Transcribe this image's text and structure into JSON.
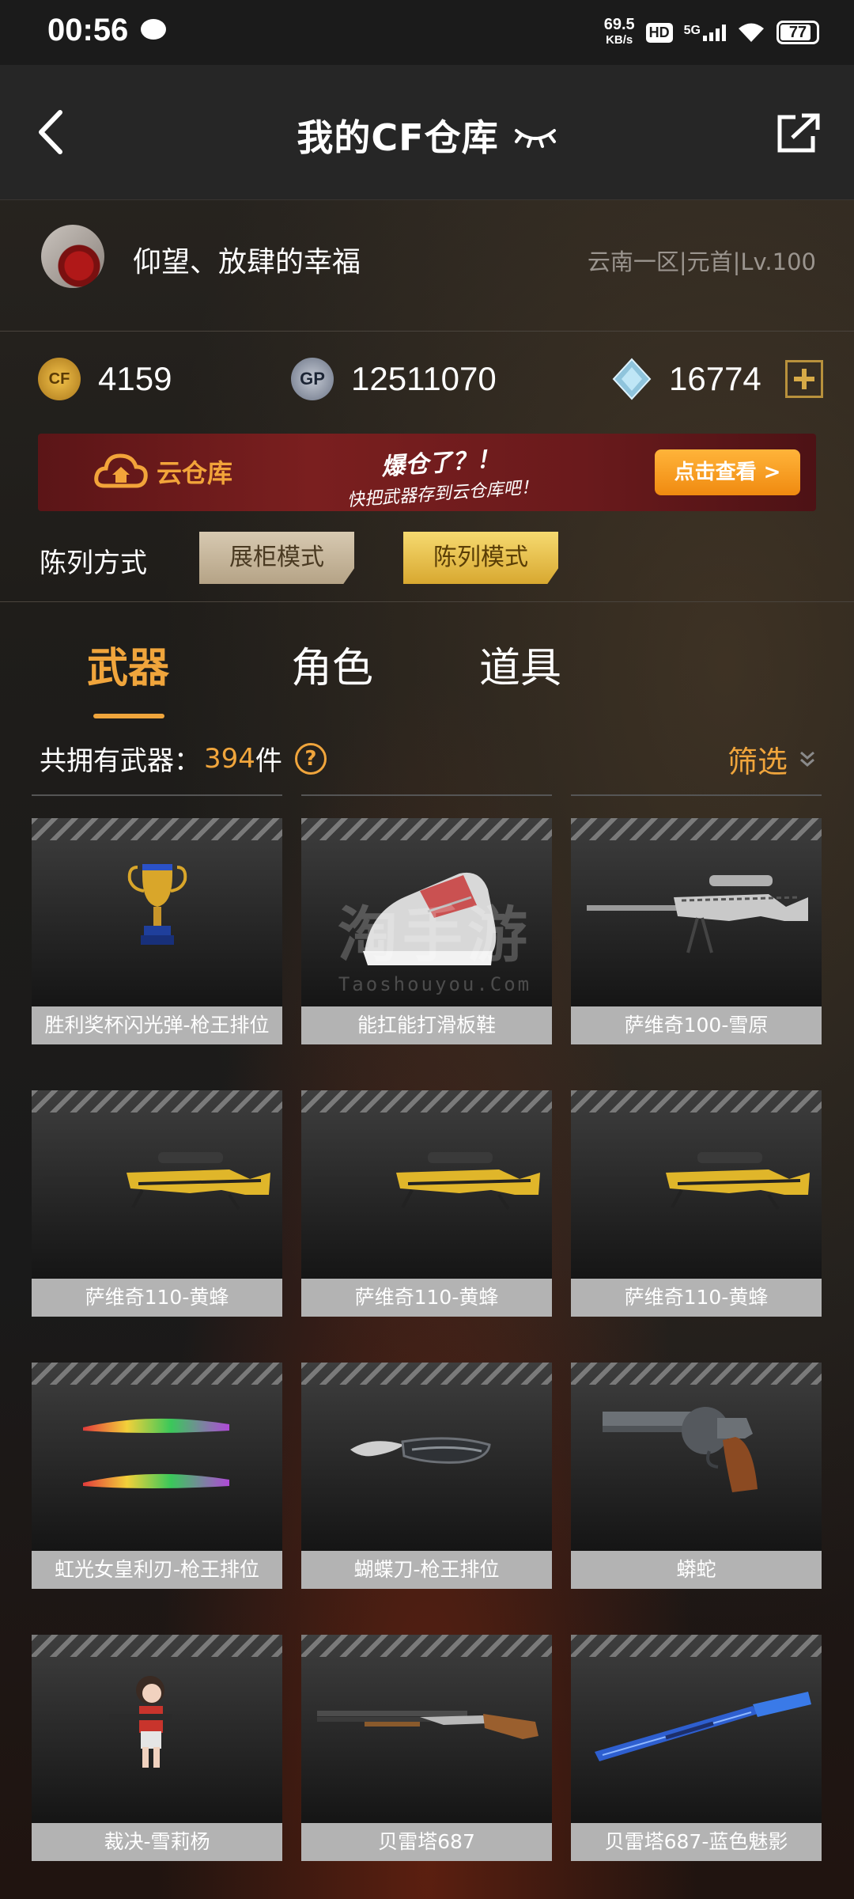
{
  "status_bar": {
    "time": "00:56",
    "net_speed_value": "69.5",
    "net_speed_unit": "KB/s",
    "hd": "HD",
    "signal": "5G",
    "battery": "77"
  },
  "app_bar": {
    "title": "我的CF仓库"
  },
  "profile": {
    "username": "仰望、放肆的幸福",
    "server_info": "云南一区|元首|Lv.100"
  },
  "currency": {
    "cf_points": "4159",
    "gp": "12511070",
    "diamonds": "16774",
    "cf_icon_text": "CF",
    "gp_icon_text": "GP"
  },
  "cloud_banner": {
    "logo_text": "云仓库",
    "slogan_line1": "爆仓了？！",
    "slogan_line2": "快把武器存到云仓库吧！",
    "button_label": "点击查看 >"
  },
  "display_mode": {
    "label": "陈列方式",
    "options": [
      "展柜模式",
      "陈列模式"
    ],
    "selected": "陈列模式"
  },
  "tabs": {
    "items": [
      "武器",
      "角色",
      "道具"
    ],
    "active": "武器"
  },
  "summary": {
    "label": "共拥有武器：",
    "count": "394",
    "unit": "件",
    "help": "?",
    "filter_label": "筛选"
  },
  "watermark": {
    "text_cn": "淘手游",
    "text_en": "Taoshouyou.Com"
  },
  "items": [
    {
      "name": "胜利奖杯闪光弹-枪王排位",
      "icon": "trophy-grenade"
    },
    {
      "name": "能扛能打滑板鞋",
      "icon": "sneaker"
    },
    {
      "name": "萨维奇100-雪原",
      "icon": "sniper-rifle-snow"
    },
    {
      "name": "萨维奇110-黄蜂",
      "icon": "sniper-rifle-yellow"
    },
    {
      "name": "萨维奇110-黄蜂",
      "icon": "sniper-rifle-yellow"
    },
    {
      "name": "萨维奇110-黄蜂",
      "icon": "sniper-rifle-yellow"
    },
    {
      "name": "虹光女皇利刃-枪王排位",
      "icon": "rainbow-blades"
    },
    {
      "name": "蝴蝶刀-枪王排位",
      "icon": "butterfly-knife"
    },
    {
      "name": "蟒蛇",
      "icon": "revolver"
    },
    {
      "name": "裁决-雪莉杨",
      "icon": "character"
    },
    {
      "name": "贝雷塔687",
      "icon": "shotgun"
    },
    {
      "name": "贝雷塔687-蓝色魅影",
      "icon": "shotgun-blue"
    }
  ],
  "colors": {
    "accent": "#f0a53c",
    "label_bg": "#b3b3b3",
    "banner_button": "#f79a1f"
  }
}
